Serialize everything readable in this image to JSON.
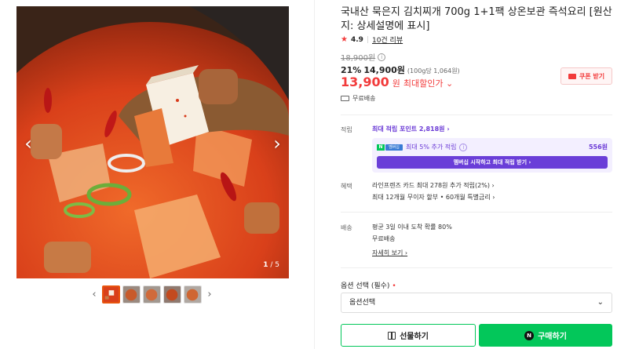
{
  "gallery": {
    "counter_current": "1",
    "counter_total": "/ 5",
    "prev_glyph": "‹",
    "next_glyph": "›",
    "thumb_prev_glyph": "‹",
    "thumb_next_glyph": "›"
  },
  "product": {
    "title": "국내산 묵은지 김치찌개 700g 1+1팩 상온보관 즉석요리 [원산지: 상세설명에 표시]",
    "rating": "4.9",
    "reviews": "10건 리뷰",
    "original_price": "18,900원",
    "discount_pct": "21%",
    "sale_price": "14,900원",
    "unit_price": "(100g당 1,064원)",
    "max_price": "13,900",
    "max_won": "원",
    "max_label": "최대할인가 ⌄",
    "coupon_label": "쿠폰 받기",
    "shipping_tag": "무료배송"
  },
  "points": {
    "label": "적립",
    "link": "최대 적립 포인트 2,818원 ›",
    "npay_badge": "멤버십",
    "npay_text": "최대 5% 추가 적립",
    "npay_amount": "556원",
    "npay_button": "멤버십 시작하고 최대 적립 받기 ›"
  },
  "benefits": {
    "label": "혜택",
    "line1": "라인프렌즈 카드 최대 278원 추가 적립(2%) ›",
    "line2": "최대 12개월 무이자 할부 • 60개월 특별금리 ›"
  },
  "delivery": {
    "label": "배송",
    "line1": "평균 3일 이내 도착 확률 80%",
    "line2": "무료배송",
    "more": "자세히 보기 ›"
  },
  "options": {
    "label": "옵션 선택 (필수)",
    "required_mark": "•",
    "select_value": "옵션선택"
  },
  "actions": {
    "gift_label": "선물하기",
    "buy_label": "구매하기",
    "buy_badge": "N"
  },
  "colors": {
    "accent_red": "#f23b3b",
    "naver_green": "#03c75a",
    "membership_purple": "#6a3ed8"
  }
}
